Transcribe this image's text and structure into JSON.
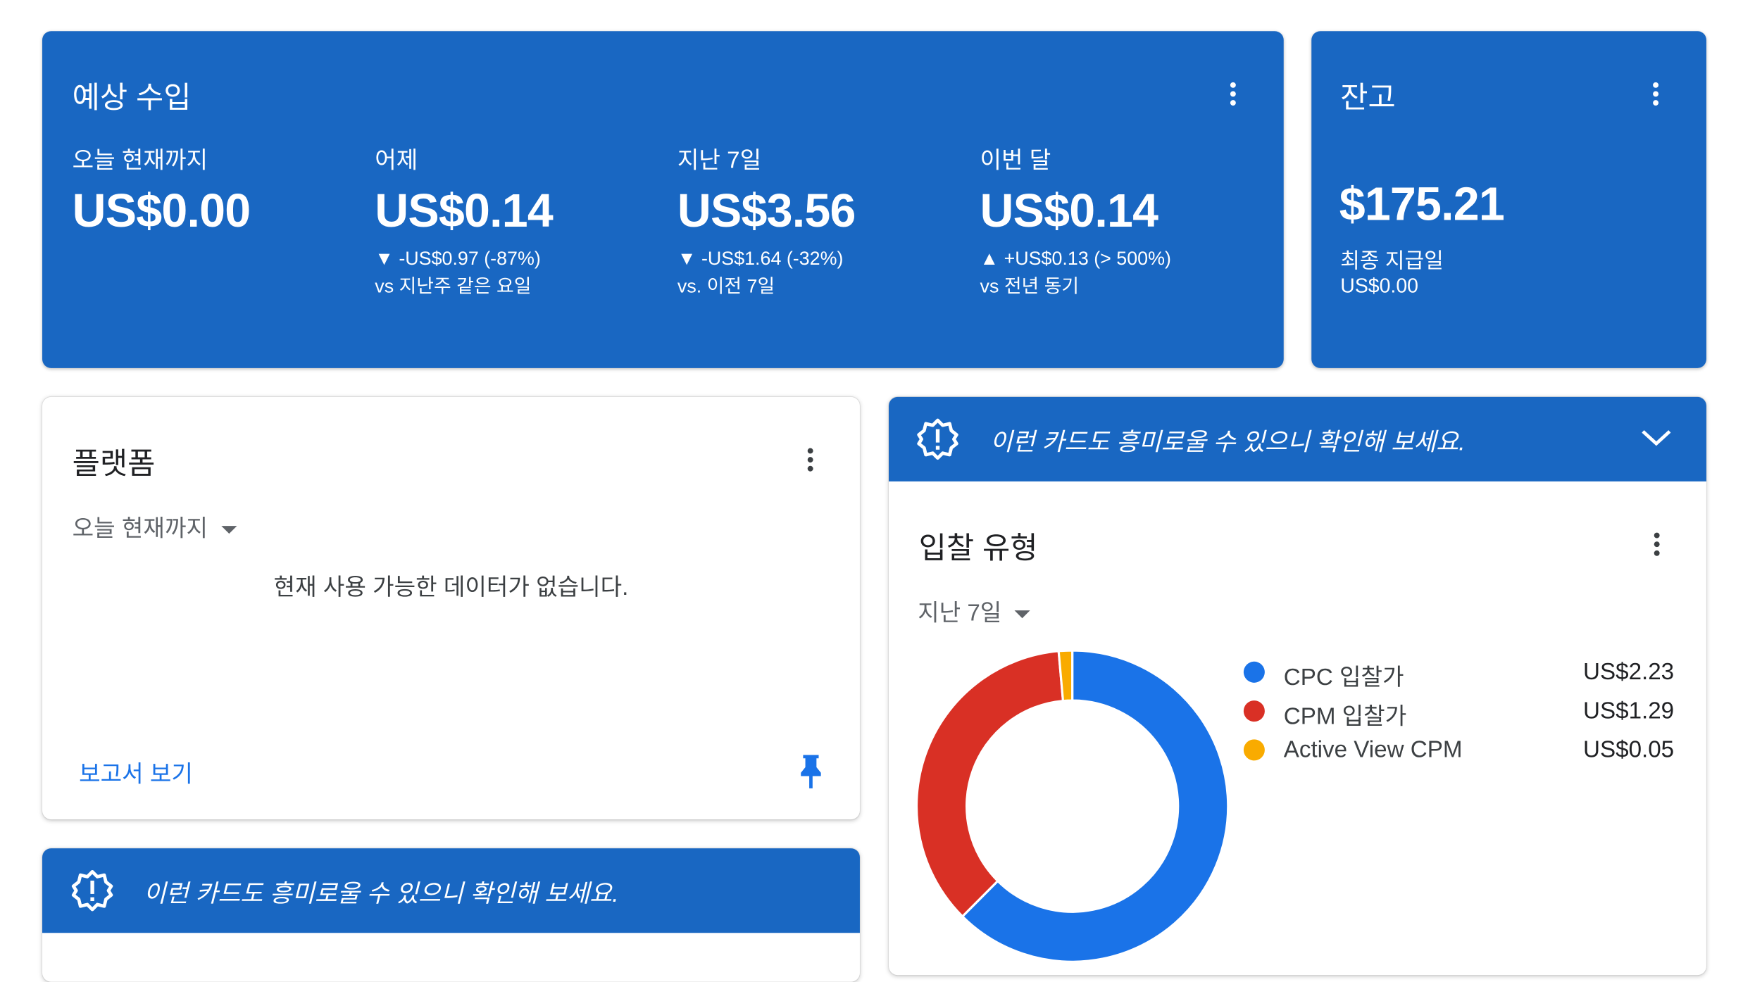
{
  "estimated_earnings": {
    "title": "예상 수입",
    "metrics": [
      {
        "label": "오늘 현재까지",
        "value": "US$0.00",
        "delta": "",
        "compare": ""
      },
      {
        "label": "어제",
        "value": "US$0.14",
        "delta": "▼ -US$0.97 (-87%)",
        "compare": "vs 지난주 같은 요일"
      },
      {
        "label": "지난 7일",
        "value": "US$3.56",
        "delta": "▼ -US$1.64 (-32%)",
        "compare": "vs. 이전 7일"
      },
      {
        "label": "이번 달",
        "value": "US$0.14",
        "delta": "▲ +US$0.13 (> 500%)",
        "compare": "vs 전년 동기"
      }
    ]
  },
  "balance": {
    "title": "잔고",
    "amount": "$175.21",
    "last_payment_label": "최종 지급일",
    "last_payment_value": "US$0.00"
  },
  "platform": {
    "title": "플랫폼",
    "range": "오늘 현재까지",
    "empty_message": "현재 사용 가능한 데이터가 없습니다.",
    "report_link": "보고서 보기"
  },
  "notice": {
    "text": "이런 카드도 흥미로울 수 있으니 확인해 보세요."
  },
  "bid_type": {
    "title": "입찰 유형",
    "range": "지난 7일",
    "legend": [
      {
        "label": "CPC 입찰가",
        "value": "US$2.23",
        "color": "#1a73e8"
      },
      {
        "label": "CPM 입찰가",
        "value": "US$1.29",
        "color": "#d93025"
      },
      {
        "label": "Active View CPM",
        "value": "US$0.05",
        "color": "#f9ab00"
      }
    ]
  },
  "chart_data": {
    "type": "pie",
    "categories": [
      "CPC 입찰가",
      "CPM 입찰가",
      "Active View CPM"
    ],
    "values": [
      2.23,
      1.29,
      0.05
    ],
    "colors": [
      "#1a73e8",
      "#d93025",
      "#f9ab00"
    ],
    "title": "입찰 유형",
    "donut": true
  }
}
